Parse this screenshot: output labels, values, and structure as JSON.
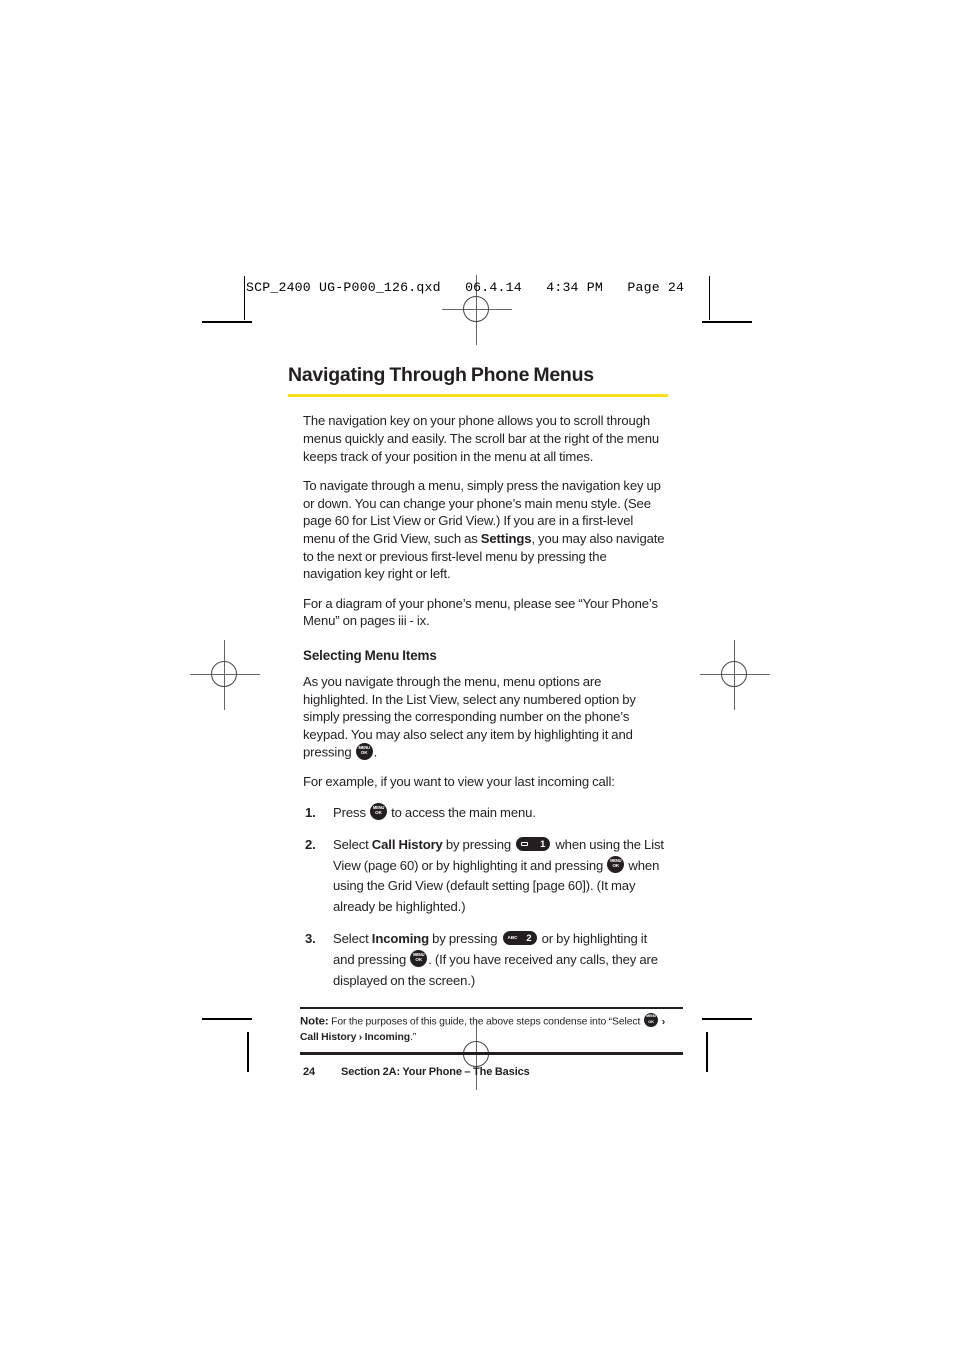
{
  "slug": {
    "text": "SCP_2400 UG-P000_126.qxd   06.4.14   4:34 PM   Page 24"
  },
  "page": {
    "title": "Navigating Through Phone Menus",
    "accent_color": "#ffde17",
    "text_color": "#231f20",
    "paragraphs": {
      "p1": "The navigation key on your phone allows you to scroll through menus quickly and easily. The scroll bar at the right of the menu keeps track of your position in the menu at all times.",
      "p2_a": "To navigate through a menu, simply press the navigation key up or down. You can change your phone’s main menu style. (See page 60 for List View or Grid View.) If you are in a first-level menu of the Grid View, such as ",
      "p2_bold": "Settings",
      "p2_b": ", you may also navigate to the next or previous first-level menu by pressing the navigation key right or left.",
      "p3": "For a diagram of your phone’s menu, please see “Your Phone’s Menu” on pages iii - ix."
    },
    "subhead": "Selecting Menu Items",
    "sub_paragraphs": {
      "s1_a": "As you navigate through the menu, menu options are highlighted. In the List View, select any numbered option by simply pressing the corresponding number on the phone’s keypad. You may also select any item by highlighting it and pressing ",
      "s1_b": ".",
      "s2": "For example, if you want to view your last incoming call:"
    },
    "steps": [
      {
        "num": "1.",
        "a": "Press ",
        "b": " to access the main menu."
      },
      {
        "num": "2.",
        "a": "Select ",
        "bold1": "Call History",
        "b": " by pressing ",
        "c": " when using the List View (page 60) or by highlighting it and pressing ",
        "d": " when using the Grid View (default setting [page 60]). (It may already be highlighted.)"
      },
      {
        "num": "3.",
        "a": "Select ",
        "bold1": "Incoming",
        "b": " by pressing ",
        "c": " or by highlighting it and pressing ",
        "d": ". (If you have received any calls, they are displayed on the screen.)"
      }
    ],
    "note": {
      "label": "Note:",
      "text_a": " For the purposes of this guide, the above steps condense into “Select ",
      "text_b": " › ",
      "bold1": "Call History",
      "text_c": " › ",
      "bold2": "Incoming",
      "text_d": ".”"
    },
    "footer": {
      "folio": "24",
      "section": "Section 2A: Your Phone – The Basics"
    }
  },
  "keys": {
    "menu_ok": {
      "top": "MENU",
      "bottom": "OK"
    },
    "key1": {
      "label": "",
      "num": "1"
    },
    "key2": {
      "label": "ABC",
      "num": "2"
    }
  }
}
